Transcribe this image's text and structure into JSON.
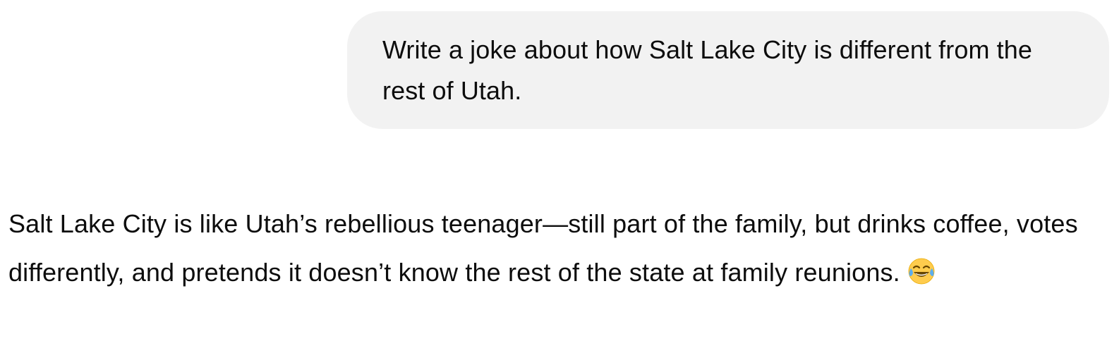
{
  "conversation": {
    "user_message": {
      "text": "Write a joke about how Salt Lake City is different from the rest of Utah."
    },
    "assistant_message": {
      "text": "Salt Lake City is like Utah’s rebellious teenager—still part of the family, but drinks coffee, votes differently, and pretends it doesn’t know the rest of the state at family reunions.",
      "emoji": "face-with-tears-of-joy-icon"
    }
  },
  "colors": {
    "background": "#ffffff",
    "user_bubble_background": "#f2f2f2",
    "text": "#0d0d0d",
    "emoji_yellow": "#ffcc4d",
    "emoji_tears": "#5dadec"
  }
}
